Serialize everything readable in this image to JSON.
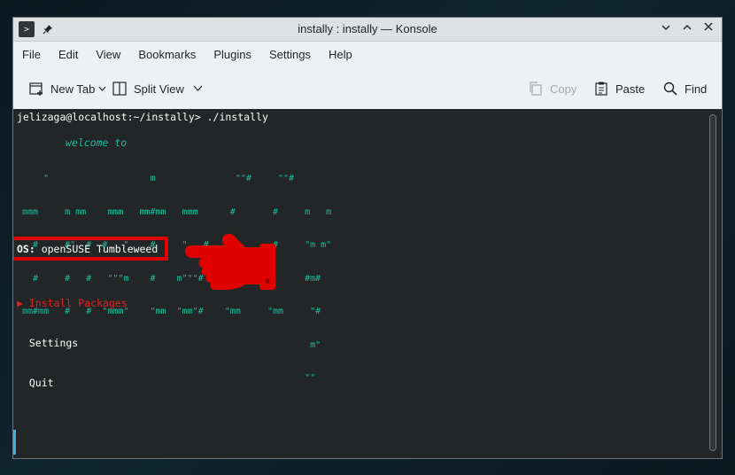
{
  "window": {
    "title": "instally : instally — Konsole",
    "app_icon": ">",
    "pin_icon": "📌",
    "minimize_glyph": "⌄",
    "maximize_glyph": "⌃",
    "close_glyph": "✕"
  },
  "menubar": {
    "items": [
      "File",
      "Edit",
      "View",
      "Bookmarks",
      "Plugins",
      "Settings",
      "Help"
    ]
  },
  "toolbar": {
    "new_tab": "New Tab",
    "split_view": "Split View",
    "copy": "Copy",
    "paste": "Paste",
    "find": "Find"
  },
  "terminal": {
    "prompt": "jelizaga@localhost:~/instally> ./instally",
    "welcome": "welcome to",
    "ascii_art": [
      "    \"                   m               \"\"#     \"\"#",
      "mmm     m mm    mmm   mm#mm   mmm      #       #     m   m",
      "  #     #\"  #  #   \"    #     \"   #    #       #     \"m m\"",
      "  #     #   #   \"\"\"m    #    m\"\"\"#    #       #      #m#",
      "mm#mm   #   #  \"mmm\"    \"mm  \"mm\"#    \"mm     \"mm     \"#",
      "                                                      m\"",
      "                                                     \"\""
    ],
    "os_label": "OS:",
    "os_value": " openSUSE Tumbleweed",
    "options": [
      {
        "label": "▶ Install Packages",
        "selected": true
      },
      {
        "label": "  Settings",
        "selected": false
      },
      {
        "label": "  Quit",
        "selected": false
      }
    ]
  },
  "colors": {
    "accent_teal": "#1abc9c",
    "highlight_red": "#e00000",
    "terminal_bg": "#232627"
  }
}
